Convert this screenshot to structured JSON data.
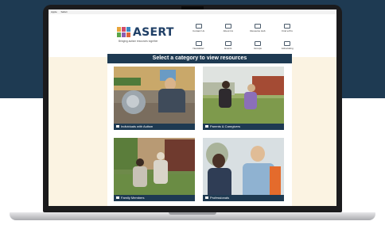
{
  "menubar": {
    "items": [
      "Apple",
      "Safari"
    ]
  },
  "brand": {
    "name": "ASERT",
    "tagline": "Bringing autism resources together",
    "colors": {
      "navy": "#1f3f66",
      "dark": "#1e3a52"
    }
  },
  "nav": {
    "items": [
      {
        "label": "Contact Us",
        "icon": "envelope-icon"
      },
      {
        "label": "About Us",
        "icon": "info-icon"
      },
      {
        "label": "Resource Hub",
        "icon": "search-icon"
      },
      {
        "label": "Find a Pro",
        "icon": "person-icon"
      },
      {
        "label": "",
        "icon": "blank-icon"
      },
      {
        "label": "Newsletter",
        "icon": "newspaper-icon"
      },
      {
        "label": "Events",
        "icon": "calendar-icon"
      },
      {
        "label": "Groups",
        "icon": "group-icon"
      },
      {
        "label": "Advocating",
        "icon": "megaphone-icon"
      },
      {
        "label": "",
        "icon": "blank-icon"
      }
    ]
  },
  "main": {
    "title": "Select a category to view resources",
    "categories": [
      {
        "label": "Individuals with Autism",
        "icon": "person-icon"
      },
      {
        "label": "Parents & Caregivers",
        "icon": "family-icon"
      },
      {
        "label": "Family Members",
        "icon": "home-icon"
      },
      {
        "label": "Professionals",
        "icon": "briefcase-icon"
      }
    ]
  }
}
